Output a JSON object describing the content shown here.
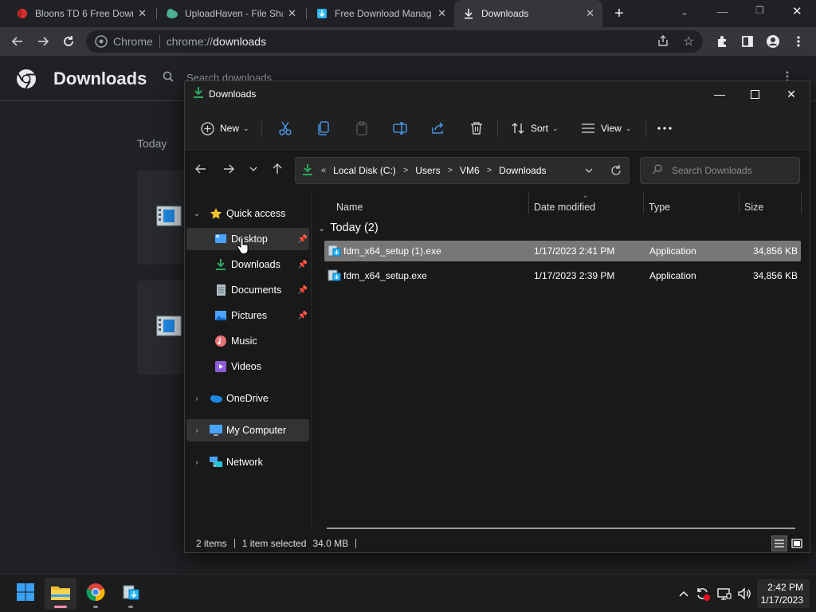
{
  "chrome": {
    "tabs": [
      {
        "title": "Bloons TD 6 Free Down",
        "active": false,
        "favicon": "bloons-icon"
      },
      {
        "title": "UploadHaven - File Sha",
        "active": false,
        "favicon": "uploadhaven-icon"
      },
      {
        "title": "Free Download Manag",
        "active": false,
        "favicon": "fdm-icon"
      },
      {
        "title": "Downloads",
        "active": true,
        "favicon": "download-icon"
      }
    ],
    "new_tab_label": "+",
    "omnibox": {
      "site_label": "Chrome",
      "scheme": "chrome://",
      "host": "downloads"
    }
  },
  "downloads_page": {
    "title": "Downloads",
    "search_placeholder": "Search downloads",
    "section_label": "Today"
  },
  "explorer": {
    "title": "Downloads",
    "commands": {
      "new": "New",
      "sort": "Sort",
      "view": "View"
    },
    "address": {
      "prefix": "«",
      "crumbs": [
        "Local Disk (C:)",
        "Users",
        "VM6",
        "Downloads"
      ]
    },
    "search_placeholder": "Search Downloads",
    "nav": {
      "quick_access": "Quick access",
      "desktop": "Desktop",
      "downloads": "Downloads",
      "documents": "Documents",
      "pictures": "Pictures",
      "music": "Music",
      "videos": "Videos",
      "onedrive": "OneDrive",
      "my_computer": "My Computer",
      "network": "Network"
    },
    "columns": {
      "name": "Name",
      "date": "Date modified",
      "type": "Type",
      "size": "Size"
    },
    "group_label": "Today (2)",
    "files": [
      {
        "name": "fdm_x64_setup (1).exe",
        "date": "1/17/2023 2:41 PM",
        "type": "Application",
        "size": "34,856 KB",
        "selected": true
      },
      {
        "name": "fdm_x64_setup.exe",
        "date": "1/17/2023 2:39 PM",
        "type": "Application",
        "size": "34,856 KB",
        "selected": false
      }
    ],
    "status": {
      "items": "2 items",
      "selection": "1 item selected",
      "size": "34.0 MB"
    }
  },
  "taskbar": {
    "clock_time": "2:42 PM",
    "clock_date": "1/17/2023"
  },
  "colors": {
    "accent_green": "#2aa860",
    "folder_yellow": "#f0c12c",
    "selection_gray": "#777777"
  }
}
